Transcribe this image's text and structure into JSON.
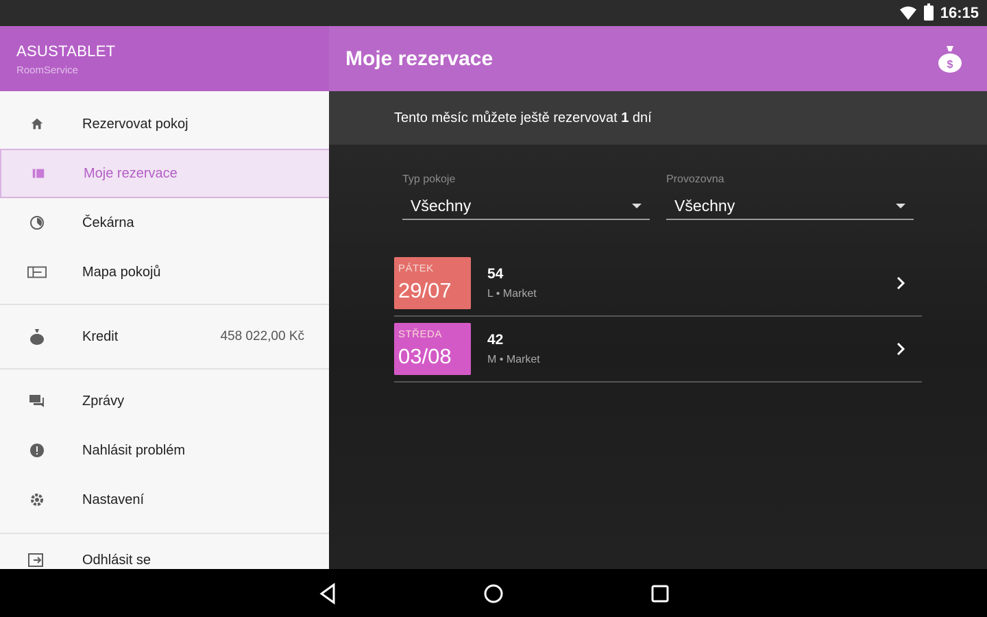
{
  "status_bar": {
    "time": "16:15",
    "wifi_icon": "wifi-icon",
    "battery_icon": "battery-icon"
  },
  "drawer": {
    "header": {
      "title": "ASUSTABLET",
      "subtitle": "RoomService"
    },
    "items": [
      {
        "label": "Rezervovat pokoj",
        "icon": "home-icon"
      },
      {
        "label": "Moje rezervace",
        "icon": "list-icon",
        "active": true
      },
      {
        "label": "Čekárna",
        "icon": "clock-icon"
      },
      {
        "label": "Mapa pokojů",
        "icon": "map-icon"
      },
      {
        "label": "Kredit",
        "icon": "money-bag-icon",
        "value": "458 022,00 Kč"
      },
      {
        "label": "Zprávy",
        "icon": "chat-icon"
      },
      {
        "label": "Nahlásit problém",
        "icon": "alert-icon"
      },
      {
        "label": "Nastavení",
        "icon": "gear-icon"
      },
      {
        "label": "Odhlásit se",
        "icon": "logout-icon"
      }
    ]
  },
  "appbar": {
    "title": "Moje rezervace",
    "action_icon": "money-bag-icon"
  },
  "banner": {
    "prefix": "Tento měsíc můžete ještě rezervovat ",
    "count": "1",
    "suffix": " dní"
  },
  "filters": [
    {
      "label": "Typ pokoje",
      "value": "Všechny"
    },
    {
      "label": "Provozovna",
      "value": "Všechny"
    }
  ],
  "reservations": [
    {
      "day": "PÁTEK",
      "date": "29/07",
      "room": "54",
      "detail": "L • Market",
      "color": "#e46f6a"
    },
    {
      "day": "STŘEDA",
      "date": "03/08",
      "room": "42",
      "detail": "M • Market",
      "color": "#d35ac6"
    }
  ],
  "colors": {
    "accent": "#b45fc6",
    "appbar": "#b868c8"
  }
}
